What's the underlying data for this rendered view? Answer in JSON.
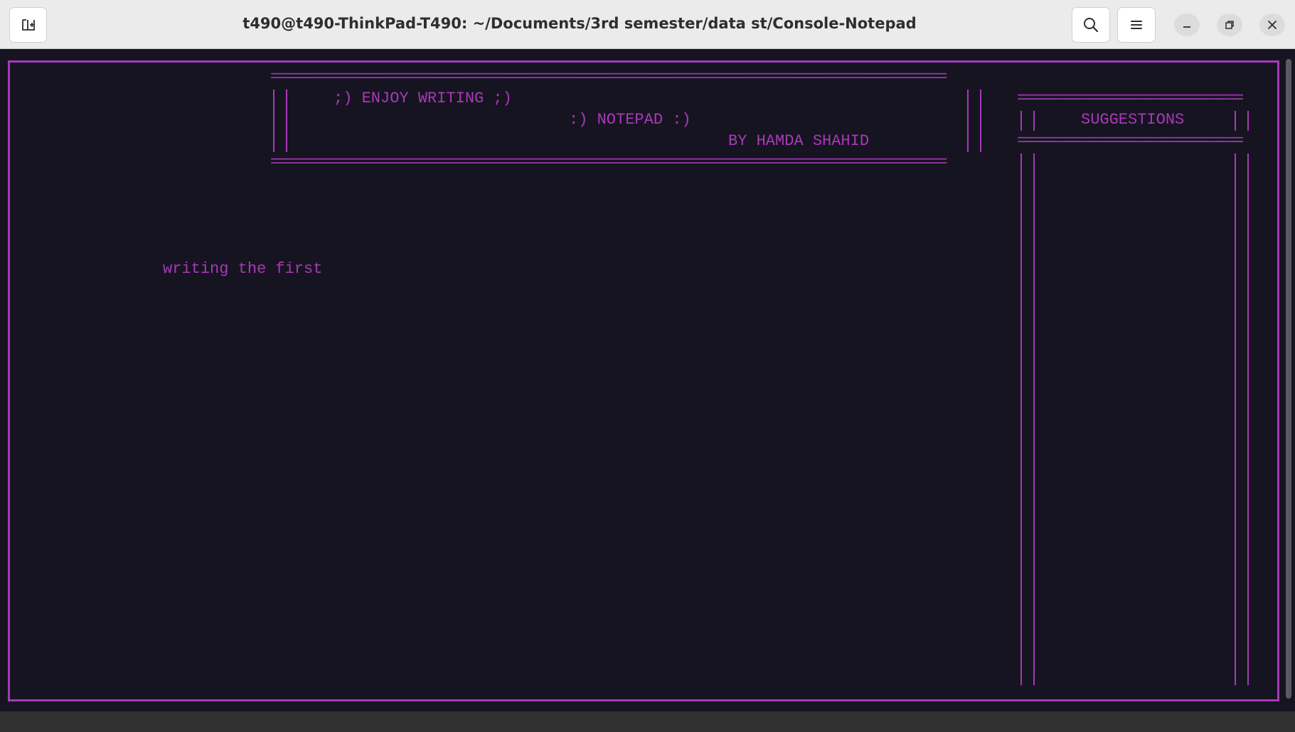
{
  "window": {
    "title": "t490@t490-ThinkPad-T490: ~/Documents/3rd semester/data st/Console-Notepad",
    "icons": {
      "new_tab": "new-tab-icon",
      "search": "search-icon",
      "menu": "hamburger-menu-icon",
      "minimize": "minimize-icon",
      "maximize": "restore-icon",
      "close": "close-icon"
    }
  },
  "terminal": {
    "accent_color": "#a63ab8",
    "background_color": "#171421",
    "header": {
      "line1": ";) ENJOY WRITING ;)",
      "line2": ":) NOTEPAD :)",
      "line3": "BY HAMDA SHAHID"
    },
    "suggestions_title": "SUGGESTIONS",
    "editor_text": "writing the first"
  }
}
